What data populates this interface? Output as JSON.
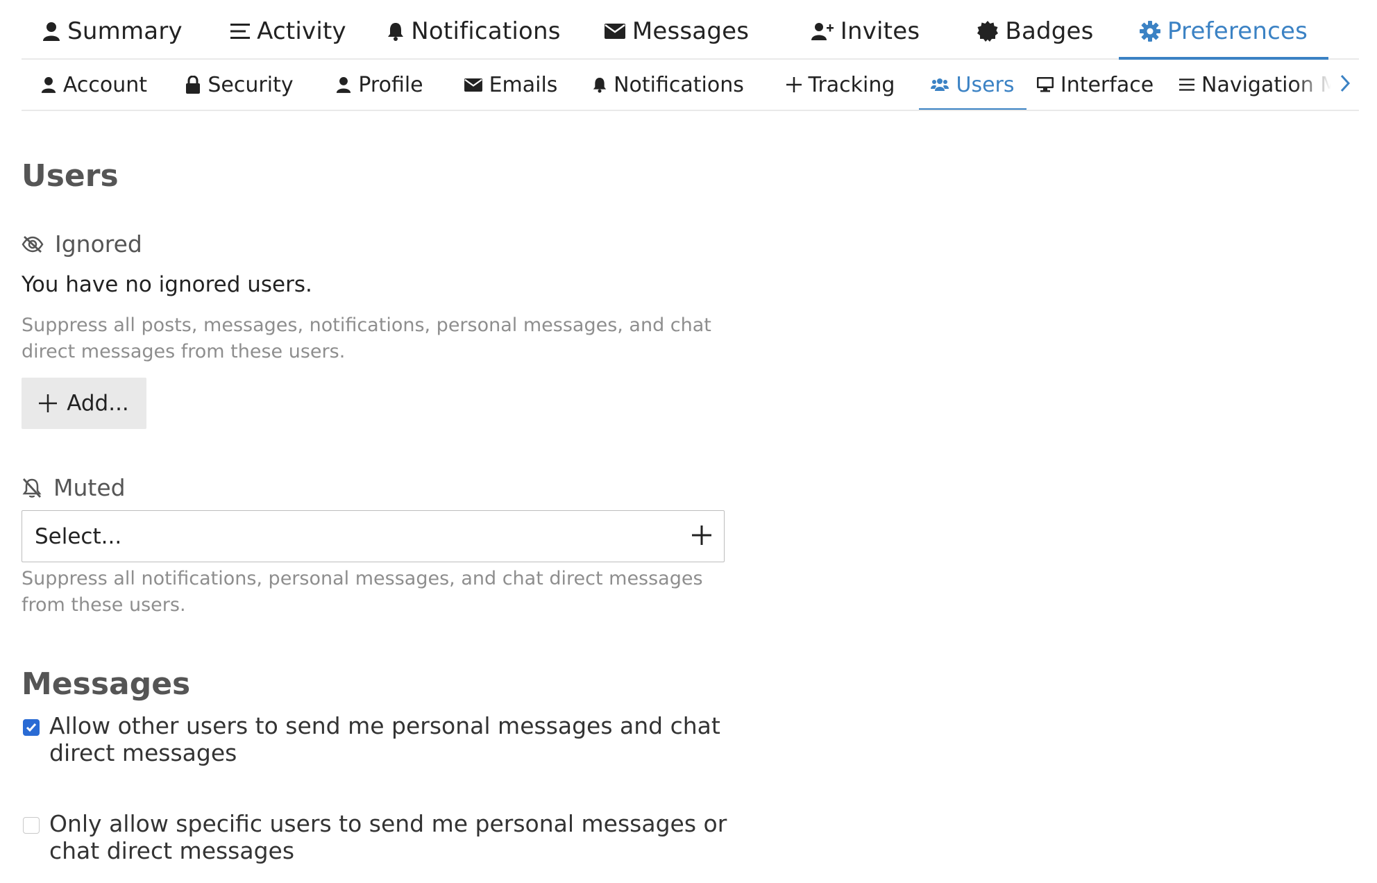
{
  "primary_nav": [
    {
      "label": "Summary",
      "icon": "user-icon",
      "active": false
    },
    {
      "label": "Activity",
      "icon": "list-icon",
      "active": false
    },
    {
      "label": "Notifications",
      "icon": "bell-icon",
      "active": false
    },
    {
      "label": "Messages",
      "icon": "envelope-icon",
      "active": false
    },
    {
      "label": "Invites",
      "icon": "user-plus-icon",
      "active": false
    },
    {
      "label": "Badges",
      "icon": "badge-icon",
      "active": false
    },
    {
      "label": "Preferences",
      "icon": "gear-icon",
      "active": true
    }
  ],
  "secondary_nav": [
    {
      "label": "Account",
      "icon": "user-icon",
      "active": false
    },
    {
      "label": "Security",
      "icon": "lock-icon",
      "active": false
    },
    {
      "label": "Profile",
      "icon": "user-icon",
      "active": false
    },
    {
      "label": "Emails",
      "icon": "envelope-icon",
      "active": false
    },
    {
      "label": "Notifications",
      "icon": "bell-icon",
      "active": false
    },
    {
      "label": "Tracking",
      "icon": "plus-icon",
      "active": false
    },
    {
      "label": "Users",
      "icon": "users-icon",
      "active": true
    },
    {
      "label": "Interface",
      "icon": "desktop-icon",
      "active": false
    },
    {
      "label": "Navigation Menu",
      "icon": "list-icon",
      "active": false
    }
  ],
  "users_section": {
    "title": "Users",
    "ignored": {
      "heading": "Ignored",
      "empty_text": "You have no ignored users.",
      "help": "Suppress all posts, messages, notifications, personal messages, and chat direct messages from these users.",
      "add_label": "Add..."
    },
    "muted": {
      "heading": "Muted",
      "select_value": "Select...",
      "help": "Suppress all notifications, personal messages, and chat direct messages from these users."
    }
  },
  "messages_section": {
    "title": "Messages",
    "options": [
      {
        "label": "Allow other users to send me personal messages and chat direct messages",
        "checked": true
      },
      {
        "label": "Only allow specific users to send me personal messages or chat direct messages",
        "checked": false
      }
    ]
  },
  "colors": {
    "accent": "#3b82c4",
    "checkbox_checked": "#2a6bd4",
    "help_text": "#8e8e8e",
    "heading": "#555555"
  }
}
